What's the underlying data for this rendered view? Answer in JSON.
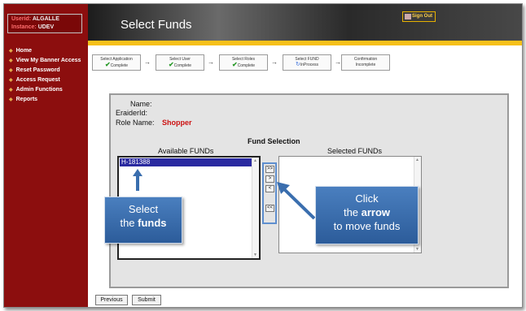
{
  "sidebar": {
    "user_label": "Userid:",
    "user_value": "ALGALLE",
    "instance_label": "Instance:",
    "instance_value": "UDEV",
    "items": [
      {
        "label": "Home"
      },
      {
        "label": "View My Banner Access"
      },
      {
        "label": "Reset Password"
      },
      {
        "label": "Access Request"
      },
      {
        "label": "Admin Functions"
      },
      {
        "label": "Reports"
      }
    ]
  },
  "header": {
    "title": "Select Funds",
    "signout_label": "Sign Out"
  },
  "steps": [
    {
      "title": "Select Application",
      "status": "Complete"
    },
    {
      "title": "Select User",
      "status": "Complete"
    },
    {
      "title": "Select Roles",
      "status": "Complete"
    },
    {
      "title": "Select FUND",
      "status": "InProcess"
    },
    {
      "title": "Confirmation",
      "status": "Incomplete"
    }
  ],
  "form": {
    "name_label": "Name:",
    "eraiderid_label": "EraiderId:",
    "role_label": "Role Name:",
    "role_value": "Shopper",
    "fund_selection_title": "Fund Selection",
    "available_label": "Available FUNDs",
    "selected_label": "Selected FUNDs",
    "available_funds": [
      "H-181388"
    ],
    "move_buttons": [
      ">>",
      ">",
      "<",
      "<<"
    ]
  },
  "callouts": {
    "left_line1": "Select",
    "left_line2_pre": "the ",
    "left_line2_bold": "funds",
    "right_line1": "Click",
    "right_line2_pre": "the ",
    "right_line2_bold": "arrow",
    "right_line3": "to move funds"
  },
  "buttons": {
    "previous": "Previous",
    "submit": "Submit"
  },
  "colors": {
    "sidebar": "#8c0e0e",
    "accent_bar": "#f6c01a",
    "callout": "#3a6eae",
    "role_value": "#cc1111"
  }
}
